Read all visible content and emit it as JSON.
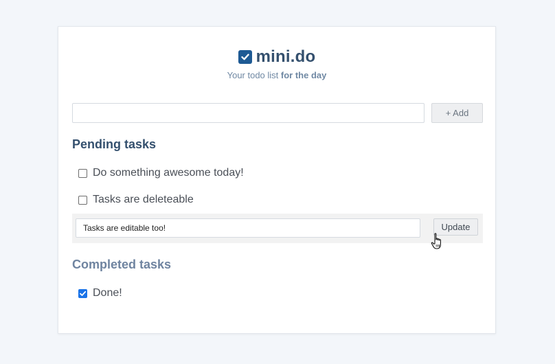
{
  "app": {
    "title": "mini.do",
    "subtitle_prefix": "Your todo list ",
    "subtitle_bold": "for the day",
    "logo_icon": "checkbox-checked-icon",
    "brand_color": "#1e5a94"
  },
  "add": {
    "input_value": "",
    "input_placeholder": "",
    "button_label": "+ Add"
  },
  "pending": {
    "heading": "Pending tasks",
    "tasks": [
      {
        "label": "Do something awesome today!",
        "checked": false
      },
      {
        "label": "Tasks are deleteable",
        "checked": false
      }
    ],
    "editing": {
      "value": "Tasks are editable too!",
      "button_label": "Update"
    }
  },
  "completed": {
    "heading": "Completed tasks",
    "tasks": [
      {
        "label": "Done!",
        "checked": true
      }
    ]
  }
}
